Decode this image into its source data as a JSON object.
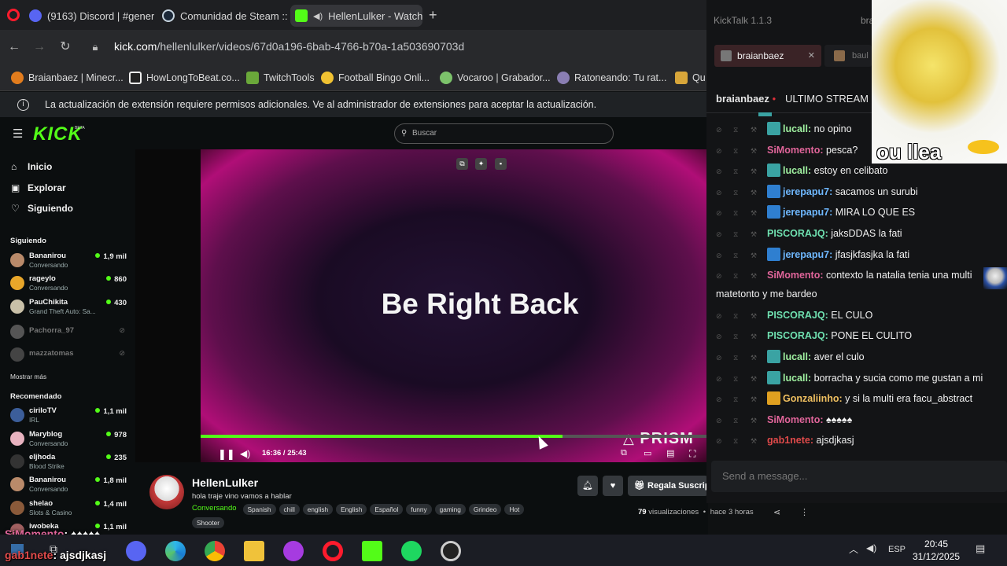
{
  "browser": {
    "tabs": [
      {
        "label": "(9163) Discord | #general"
      },
      {
        "label": "Comunidad de Steam :: Br"
      },
      {
        "label": "HellenLulker - Watch t"
      }
    ],
    "discord_badge": "9k+",
    "new_tab_label": "+",
    "url_host": "kick.com",
    "url_path": "/hellenlulker/videos/67d0a196-6bab-4766-b70a-1a503690703d",
    "bookmarks": [
      {
        "label": "Braianbaez | Minecr...",
        "color": "#e27c1d"
      },
      {
        "label": "HowLongToBeat.co...",
        "color": "#222222"
      },
      {
        "label": "TwitchTools",
        "color": "#6aa83a"
      },
      {
        "label": "Football Bingo Onli...",
        "color": "#f1c232"
      },
      {
        "label": "Vocaroo | Grabador...",
        "color": "#7cc36b"
      },
      {
        "label": "Ratoneando: Tu rat...",
        "color": "#8a7eb3"
      },
      {
        "label": "Qu",
        "color": "#d8a63a"
      }
    ],
    "info_message": "La actualización de extensión requiere permisos adicionales. Ve al administrador de extensiones para aceptar la actualización."
  },
  "kick": {
    "logo": "KICK",
    "logo_beta": "BETA",
    "search_placeholder": "Buscar",
    "nav": [
      {
        "label": "Inicio",
        "icon": "home-icon"
      },
      {
        "label": "Explorar",
        "icon": "compass-icon"
      },
      {
        "label": "Siguiendo",
        "icon": "heart-icon"
      }
    ],
    "following_header": "Siguiendo",
    "following": [
      {
        "name": "Bananirou",
        "sub": "Conversando",
        "viewers": "1,9 mil",
        "color": "#b98a6a"
      },
      {
        "name": "rageylo",
        "sub": "Conversando",
        "viewers": "860",
        "color": "#e8a62a"
      },
      {
        "name": "PauChikita",
        "sub": "Grand Theft Auto: Sa...",
        "viewers": "430",
        "color": "#c9c0a8"
      },
      {
        "name": "Pachorra_97",
        "sub": "",
        "viewers": "",
        "color": "#555555"
      },
      {
        "name": "mazzatomas",
        "sub": "",
        "viewers": "",
        "color": "#444444"
      }
    ],
    "show_more": "Mostrar más",
    "recommended_header": "Recomendado",
    "recommended": [
      {
        "name": "ciriloTV",
        "sub": "IRL",
        "viewers": "1,1 mil",
        "color": "#3c5e9a"
      },
      {
        "name": "Maryblog",
        "sub": "Conversando",
        "viewers": "978",
        "color": "#e8b3c0"
      },
      {
        "name": "eljhoda",
        "sub": "Blood Strike",
        "viewers": "235",
        "color": "#333333"
      },
      {
        "name": "Bananirou",
        "sub": "Conversando",
        "viewers": "1,8 mil",
        "color": "#b98a6a"
      },
      {
        "name": "shelao",
        "sub": "Slots & Casino",
        "viewers": "1,4 mil",
        "color": "#8a5a3a"
      },
      {
        "name": "iwobeka",
        "sub": "",
        "viewers": "1,1 mil",
        "color": "#a06060"
      }
    ],
    "player": {
      "brb_text": "Be Right Back",
      "time": "16:36 / 25:43",
      "progress": 0.713,
      "watermark": "PRISM"
    },
    "stream": {
      "name": "HellenLulker",
      "title": "hola traje vino vamos a hablar",
      "category": "Conversando",
      "tags": [
        "Spanish",
        "chill",
        "english",
        "English",
        "Español",
        "funny",
        "gaming",
        "Grindeo",
        "Hot",
        "Shooter"
      ],
      "subscribe_label": "Regala Suscrip",
      "views_count": "79",
      "views_label": "visualizaciones",
      "ago": "hace 3 horas"
    }
  },
  "kicktalk": {
    "app_title": "KickTalk 1.1.3",
    "tabs": [
      {
        "label": "braianbaez"
      },
      {
        "label": "baul"
      }
    ],
    "top_partial": "bra",
    "channel": "braianbaez",
    "channel_tab": "ULTIMO STREAM",
    "messages": [
      {
        "user": "lucall",
        "text": "no opino",
        "color": "#9ff0a0",
        "badge": "#3aa3a3"
      },
      {
        "user": "SiMomento",
        "text": "pesca?",
        "color": "#e0659a",
        "badge": ""
      },
      {
        "user": "lucall",
        "text": "estoy en celibato",
        "color": "#9ff0a0",
        "badge": "#3aa3a3"
      },
      {
        "user": "jerepapu7",
        "text": "sacamos un surubi",
        "color": "#6fb8ff",
        "badge": "#2f7fd0"
      },
      {
        "user": "jerepapu7",
        "text": "MIRA LO QUE ES",
        "color": "#6fb8ff",
        "badge": "#2f7fd0"
      },
      {
        "user": "PISCORAJQ",
        "text": "jaksDDAS la fati",
        "color": "#6fe0b0",
        "badge": ""
      },
      {
        "user": "jerepapu7",
        "text": "jfasjkfasjka la fati",
        "color": "#6fb8ff",
        "badge": "#2f7fd0"
      },
      {
        "user": "SiMomento",
        "text": "contexto la natalia tenia una multi",
        "color": "#e0659a",
        "badge": ""
      },
      {
        "user": "",
        "text": "matetonto y me bardeo",
        "color": "",
        "badge": ""
      },
      {
        "user": "PISCORAJQ",
        "text": "EL CULO",
        "color": "#6fe0b0",
        "badge": ""
      },
      {
        "user": "PISCORAJQ",
        "text": "PONE EL CULITO",
        "color": "#6fe0b0",
        "badge": ""
      },
      {
        "user": "lucall",
        "text": "aver el culo",
        "color": "#9ff0a0",
        "badge": "#3aa3a3"
      },
      {
        "user": "lucall",
        "text": "borracha y sucia como me gustan a mi",
        "color": "#9ff0a0",
        "badge": "#3aa3a3"
      },
      {
        "user": "Gonzaliinho",
        "text": "y si la multi era facu_abstract",
        "color": "#f0c060",
        "badge": "#e0a020"
      },
      {
        "user": "SiMomento",
        "text": "♠♠♠♠♠",
        "color": "#e0659a",
        "badge": ""
      },
      {
        "user": "gab1nete",
        "text": "ajsdjkasj",
        "color": "#e04a4a",
        "badge": ""
      }
    ],
    "input_placeholder": "Send a message...",
    "meme_text": "ou llea"
  },
  "overlay": {
    "line1_user": "SiMomento",
    "line1_text": ": ♠♠♠♠♠",
    "line2_user": "gab1nete",
    "line2_text": ": ajsdjkasj"
  },
  "taskbar": {
    "lang": "ESP",
    "time": "20:45",
    "date": "31/12/2025"
  }
}
